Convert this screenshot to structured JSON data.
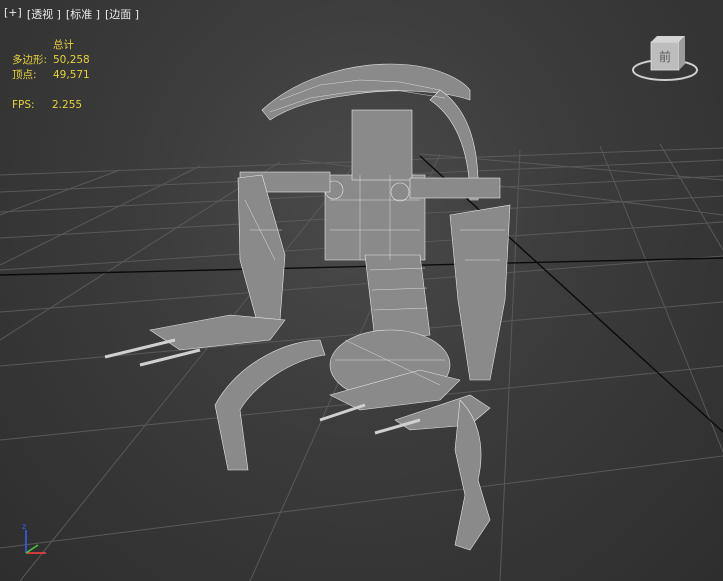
{
  "viewport_menu": {
    "plus": "[+]",
    "view": "[透视 ]",
    "shading": "[标准 ]",
    "mode": "[边面 ]"
  },
  "stats": {
    "header": "总计",
    "polygons_label": "多边形:",
    "polygons_value": "50,258",
    "vertices_label": "顶点:",
    "vertices_value": "49,571",
    "fps_label": "FPS:",
    "fps_value": "2.255"
  },
  "viewcube": {
    "face_label": "前"
  },
  "colors": {
    "stats_text": "#e6d23a",
    "grid": "#5a5a5a",
    "grid_main": "#0a0a0a",
    "mesh_fill": "#8a8a8a",
    "wire": "#e8e8e8"
  },
  "icons": [
    "viewcube-icon",
    "axis-gizmo-icon"
  ]
}
